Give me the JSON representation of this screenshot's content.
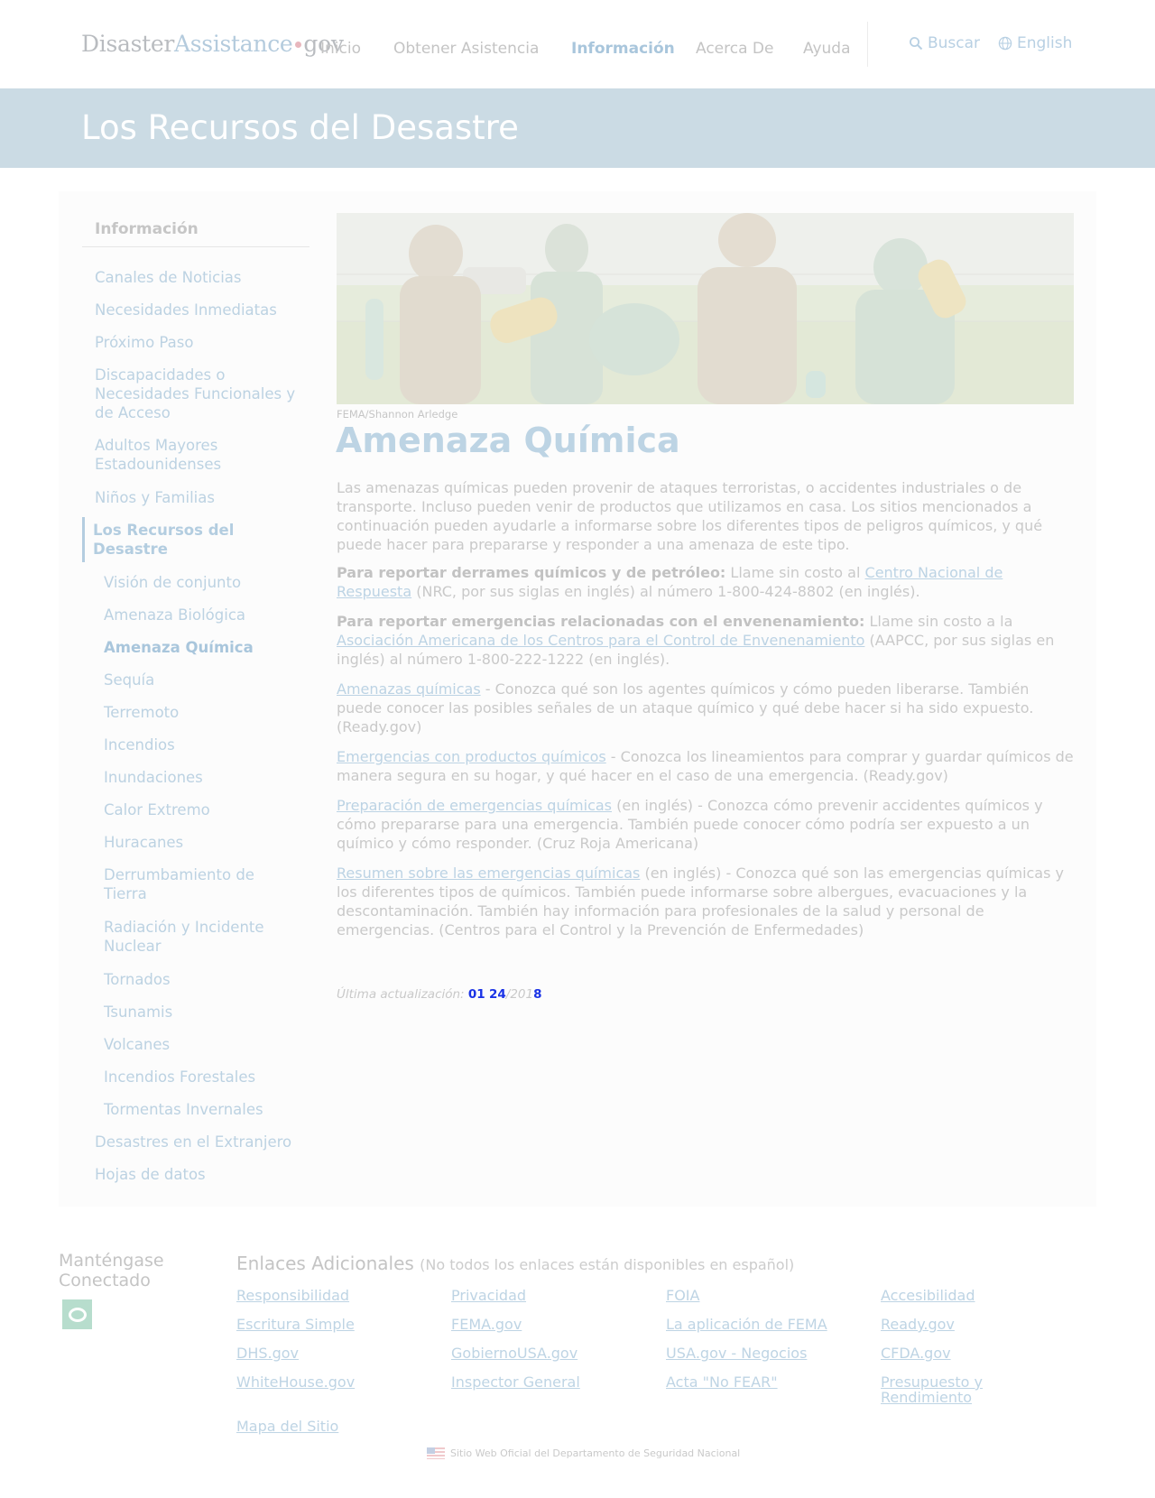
{
  "header": {
    "logo": {
      "part1": "Disaster",
      "part2": "Assistance",
      "part3": "gov"
    },
    "nav": [
      {
        "label": "Inicio"
      },
      {
        "label": "Obtener Asistencia"
      },
      {
        "label": "Información",
        "active": true
      },
      {
        "label": "Acerca De"
      },
      {
        "label": "Ayuda"
      }
    ],
    "search_label": "Buscar",
    "language_label": "English"
  },
  "banner": {
    "title": "Los Recursos del Desastre"
  },
  "sidebar": {
    "title": "Información",
    "items": [
      "Canales de Noticias",
      "Necesidades Inmediatas",
      "Próximo Paso",
      "Discapacidades o Necesidades Funcionales y de Acceso",
      "Adultos Mayores Estadounidenses",
      "Niños y Familias",
      "Los Recursos del Desastre",
      "Visión de conjunto",
      "Amenaza Biológica",
      "Amenaza Química",
      "Sequía",
      "Terremoto",
      "Incendios",
      "Inundaciones",
      "Calor Extremo",
      "Huracanes",
      "Derrumbamiento de Tierra",
      "Radiación y Incidente Nuclear",
      "Tornados",
      "Tsunamis",
      "Volcanes",
      "Incendios Forestales",
      "Tormentas Invernales",
      "Desastres en el Extranjero",
      "Hojas de datos"
    ]
  },
  "content": {
    "image_credit": "FEMA/Shannon Arledge",
    "title": "Amenaza Química",
    "intro": "Las amenazas químicas pueden provenir de ataques terroristas, o accidentes industriales o de transporte. Incluso pueden venir de productos que utilizamos en casa. Los sitios mencionados a continuación pueden ayudarle a informarse sobre los diferentes tipos de peligros químicos, y qué puede hacer para prepararse y responder a una amenaza de este tipo.",
    "report_spills": {
      "bold": "Para reportar derrames químicos y de petróleo:",
      "before": " Llame sin costo al ",
      "link": "Centro Nacional de Respuesta",
      "after": " (NRC, por sus siglas en inglés) al número 1-800-424-8802 (en inglés)."
    },
    "report_poison": {
      "bold": "Para reportar emergencias relacionadas con el envenenamiento:",
      "before": " Llame sin costo a la ",
      "link": "Asociación Americana de los Centros para el Control de Envenenamiento",
      "after": " (AAPCC, por sus siglas en inglés) al número 1-800-222-1222 (en inglés)."
    },
    "resources": [
      {
        "link": "Amenazas químicas",
        "text": " - Conozca qué son los agentes químicos y cómo pueden liberarse. También puede conocer las posibles señales de un ataque químico y qué debe hacer si ha sido expuesto. (Ready.gov)"
      },
      {
        "link": "Emergencias con productos químicos",
        "text": " - Conozca los lineamientos para comprar y guardar químicos de manera segura en su hogar, y qué hacer en el caso de una emergencia. (Ready.gov)"
      },
      {
        "link": "Preparación de emergencias químicas",
        "text": " (en inglés) - Conozca cómo prevenir accidentes químicos y cómo prepararse para una emergencia. También puede conocer cómo podría ser expuesto a un químico y cómo responder. (Cruz Roja Americana)"
      },
      {
        "link": "Resumen sobre las emergencias químicas",
        "text": " (en inglés) - Conozca qué son las emergencias químicas y los diferentes tipos de químicos. También puede informarse sobre albergues, evacuaciones y la descontaminación. También hay información para profesionales de la salud y personal de emergencias. (Centros para el Control y la Prevención de Enfermedades)"
      }
    ],
    "updated_label": "Última actualización:",
    "updated_glitch1": "01",
    "updated_glitch2": "24",
    "updated_year": "/201",
    "updated_glitch3": "8"
  },
  "footer": {
    "stay_connected": "Manténgase Conectado",
    "links_title": "Enlaces Adicionales",
    "links_note": "(No todos los enlaces están disponibles en español)",
    "links": [
      "Responsibilidad",
      "Privacidad",
      "FOIA",
      "Accesibilidad",
      "Escritura Simple",
      "FEMA.gov",
      "La aplicación de FEMA",
      "Ready.gov",
      "DHS.gov",
      "GobiernoUSA.gov",
      "USA.gov - Negocios",
      "CFDA.gov",
      "WhiteHouse.gov",
      "Inspector General",
      "Acta \"No FEAR\"",
      "Presupuesto y Rendimiento",
      "Mapa del Sitio"
    ],
    "official": "Sitio Web Oficial del Departamento de Seguridad Nacional"
  },
  "colors": {
    "accent": "#a9c6dc",
    "banner": "#cbdbe4",
    "link": "#bcd3e4",
    "social": "#b7ddcd"
  }
}
